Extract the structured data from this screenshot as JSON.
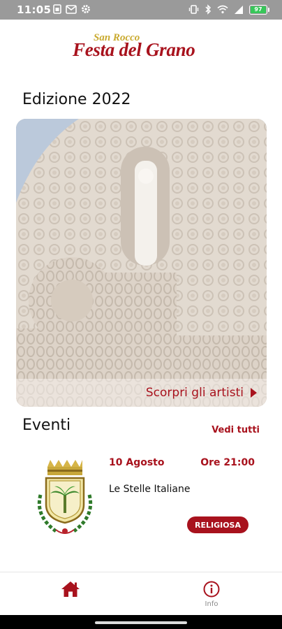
{
  "status_bar": {
    "time": "11:05",
    "battery": "97",
    "left_icons": [
      "sim-icon",
      "gmail-icon",
      "settings-icon"
    ],
    "right_icons": [
      "vibrate-icon",
      "bluetooth-icon",
      "wifi-icon",
      "signal-icon",
      "battery-icon"
    ]
  },
  "header": {
    "logo_small": "San Rocco",
    "logo_big": "Festa del Grano"
  },
  "edition": {
    "title": "Edizione 2022",
    "cta_label": "Scorpri gli artisti"
  },
  "events": {
    "title": "Eventi",
    "see_all": "Vedi tutti",
    "items": [
      {
        "date": "10 Agosto",
        "time": "Ore 21:00",
        "title": "Le Stelle Italiane",
        "badge": "RELIGIOSA"
      }
    ]
  },
  "nav": {
    "home_label": "",
    "info_label": "Info"
  },
  "colors": {
    "brand": "#a8121d",
    "logo_gold": "#c9a92d",
    "status_bar": "#9a9a9a"
  }
}
